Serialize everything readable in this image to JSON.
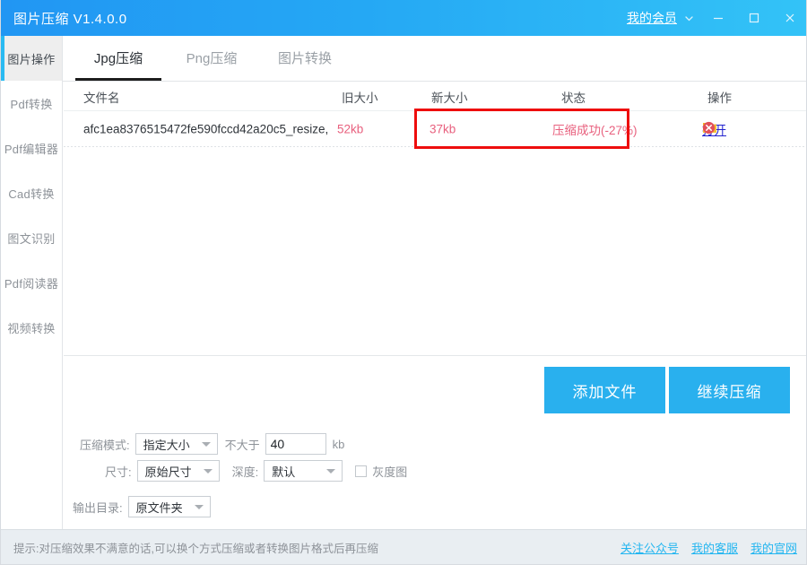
{
  "titlebar": {
    "app_title": "图片压缩 V1.4.0.0",
    "member_link": "我的会员",
    "chevron_icon": "chevron-down-icon",
    "minimize_icon": "minimize-icon",
    "maximize_icon": "maximize-icon",
    "close_icon": "close-icon",
    "gradient_from": "#2196f3",
    "gradient_to": "#33c3f7"
  },
  "sidebar": {
    "items": [
      {
        "label": "图片操作",
        "active": true
      },
      {
        "label": "Pdf转换",
        "active": false
      },
      {
        "label": "Pdf编辑器",
        "active": false
      },
      {
        "label": "Cad转换",
        "active": false
      },
      {
        "label": "图文识别",
        "active": false
      },
      {
        "label": "Pdf阅读器",
        "active": false
      },
      {
        "label": "视频转换",
        "active": false
      }
    ],
    "accent_color": "#29baf2"
  },
  "tabs": [
    {
      "label": "Jpg压缩",
      "active": true
    },
    {
      "label": "Png压缩",
      "active": false
    },
    {
      "label": "图片转换",
      "active": false
    }
  ],
  "table": {
    "headers": {
      "filename": "文件名",
      "old_size": "旧大小",
      "new_size": "新大小",
      "status": "状态",
      "action": "操作"
    },
    "rows": [
      {
        "filename": "afc1ea8376515472fe590fccd42a20c5_resize,",
        "old_size": "52kb",
        "new_size": "37kb",
        "status": "压缩成功(-27%)",
        "open_label": "打开",
        "folder_icon": "folder-icon",
        "delete_icon": "delete-circle-icon"
      }
    ],
    "row_text_color": "#e8607e",
    "annotation_box_color": "#ee0d0d"
  },
  "actions": {
    "add_file": "添加文件",
    "continue_compress": "继续压缩",
    "button_color": "#29b0ee"
  },
  "settings": {
    "mode_label": "压缩模式:",
    "mode_value": "指定大小",
    "limit_label": "不大于",
    "limit_value": "40",
    "limit_unit": "kb",
    "size_label": "尺寸:",
    "size_value": "原始尺寸",
    "depth_label": "深度:",
    "depth_value": "默认",
    "grayscale_label": "灰度图",
    "grayscale_checked": false,
    "output_label": "输出目录:",
    "output_value": "原文件夹"
  },
  "statusbar": {
    "hint": "提示:对压缩效果不满意的话,可以换个方式压缩或者转换图片格式后再压缩",
    "links": [
      {
        "label": "关注公众号"
      },
      {
        "label": "我的客服"
      },
      {
        "label": "我的官网"
      }
    ],
    "link_color": "#24b6f0"
  }
}
